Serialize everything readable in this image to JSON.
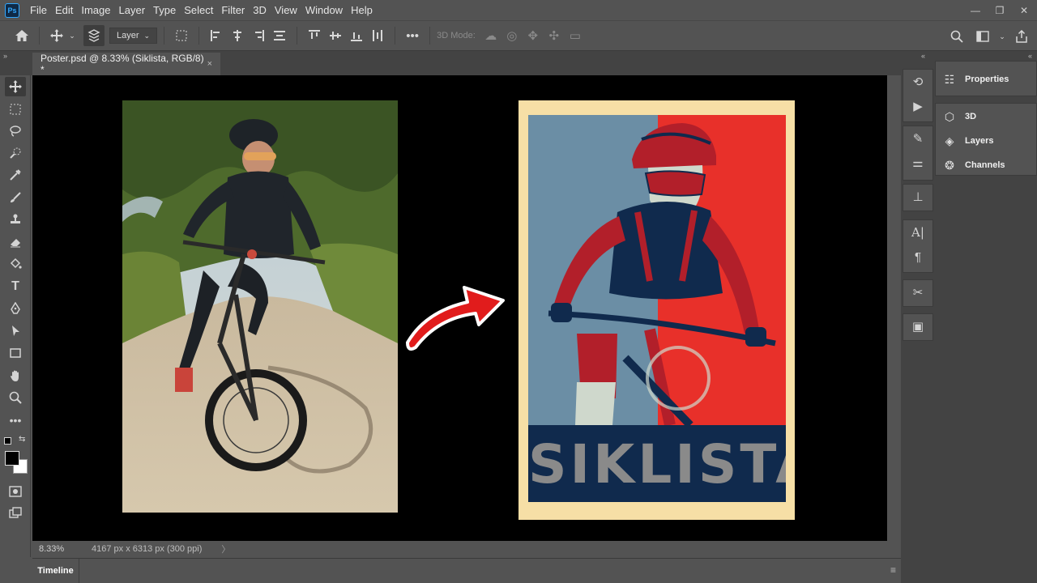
{
  "app": {
    "logo_text": "Ps"
  },
  "menu": [
    "File",
    "Edit",
    "Image",
    "Layer",
    "Type",
    "Select",
    "Filter",
    "3D",
    "View",
    "Window",
    "Help"
  ],
  "window_controls": {
    "minimize": "—",
    "restore": "❐",
    "close": "✕"
  },
  "options_bar": {
    "layer_select": "Layer",
    "mode3d_label": "3D Mode:"
  },
  "document": {
    "tab_title": "Poster.psd @ 8.33% (Siklista, RGB/8) *",
    "tab_close": "×"
  },
  "status": {
    "zoom": "8.33%",
    "dimensions": "4167 px x 6313 px (300 ppi)",
    "chevron": "〉"
  },
  "timeline": {
    "label": "Timeline"
  },
  "panels": [
    {
      "label": "Properties",
      "icon": "properties-icon"
    },
    {
      "label": "3D",
      "icon": "cube-icon"
    },
    {
      "label": "Layers",
      "icon": "layers-icon"
    },
    {
      "label": "Channels",
      "icon": "channels-icon"
    }
  ],
  "poster": {
    "title": "SIKLISTA"
  },
  "colors": {
    "poster_frame": "#f6dfa6",
    "poster_blue": "#6b8ea5",
    "poster_red": "#e8302a",
    "poster_navy": "#102a4d",
    "arrow_red": "#e11c1c",
    "accent": "#31a8ff"
  }
}
